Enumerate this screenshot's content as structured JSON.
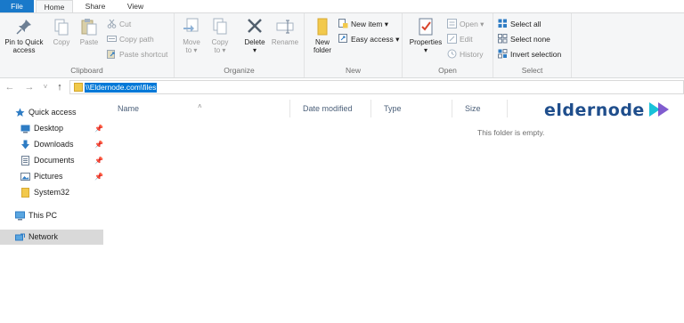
{
  "tabs": {
    "file": "File",
    "home": "Home",
    "share": "Share",
    "view": "View"
  },
  "clipboard": {
    "pin": "Pin to Quick access",
    "pin_l1": "Pin to Quick",
    "pin_l2": "access",
    "copy": "Copy",
    "paste": "Paste",
    "cut": "Cut",
    "copy_path": "Copy path",
    "paste_shortcut": "Paste shortcut",
    "label": "Clipboard"
  },
  "organize": {
    "move_to_l1": "Move",
    "move_to_l2": "to ▾",
    "copy_to_l1": "Copy",
    "copy_to_l2": "to ▾",
    "delete": "Delete",
    "delete_caret": "▾",
    "rename": "Rename",
    "label": "Organize"
  },
  "new": {
    "new_folder_l1": "New",
    "new_folder_l2": "folder",
    "new_item": "New item ▾",
    "easy_access": "Easy access ▾",
    "label": "New"
  },
  "open": {
    "properties": "Properties",
    "properties_caret": "▾",
    "open": "Open ▾",
    "edit": "Edit",
    "history": "History",
    "label": "Open"
  },
  "select": {
    "select_all": "Select all",
    "select_none": "Select none",
    "invert": "Invert selection",
    "label": "Select"
  },
  "address": {
    "path": "\\\\Eldernode.com\\files"
  },
  "nav": {
    "quick_access": "Quick access",
    "desktop": "Desktop",
    "downloads": "Downloads",
    "documents": "Documents",
    "pictures": "Pictures",
    "system32": "System32",
    "this_pc": "This PC",
    "network": "Network"
  },
  "columns": {
    "name": "Name",
    "date_modified": "Date modified",
    "type": "Type",
    "size": "Size"
  },
  "empty_message": "This folder is empty.",
  "watermark": "eldernode",
  "colors": {
    "accent": "#0078d7",
    "file_tab": "#1979ca",
    "logo_blue": "#1f4e8c",
    "logo_cyan": "#19c2d9",
    "logo_purple": "#6a3fc7"
  }
}
